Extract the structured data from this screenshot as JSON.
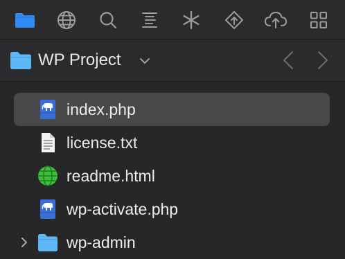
{
  "toolbar": {
    "tools": [
      {
        "icon": "folder-icon",
        "name": "Files",
        "active": true
      },
      {
        "icon": "globe-icon",
        "name": "Web"
      },
      {
        "icon": "search-icon",
        "name": "Search"
      },
      {
        "icon": "outline-icon",
        "name": "Outline"
      },
      {
        "icon": "asterisk-icon",
        "name": "Snippets"
      },
      {
        "icon": "git-icon",
        "name": "Git"
      },
      {
        "icon": "cloud-icon",
        "name": "Publish"
      },
      {
        "icon": "grid-icon",
        "name": "More"
      }
    ],
    "active_color": "#2f8cf5",
    "icon_color": "#9c9c9f"
  },
  "project": {
    "title": "WP Project",
    "folder_color": "#5fb8f6"
  },
  "files": [
    {
      "name": "index.php",
      "icon": "php-file-icon",
      "selected": true
    },
    {
      "name": "license.txt",
      "icon": "text-file-icon"
    },
    {
      "name": "readme.html",
      "icon": "html-globe-icon"
    },
    {
      "name": "wp-activate.php",
      "icon": "php-file-icon"
    },
    {
      "name": "wp-admin",
      "icon": "folder-icon",
      "expandable": true
    }
  ]
}
